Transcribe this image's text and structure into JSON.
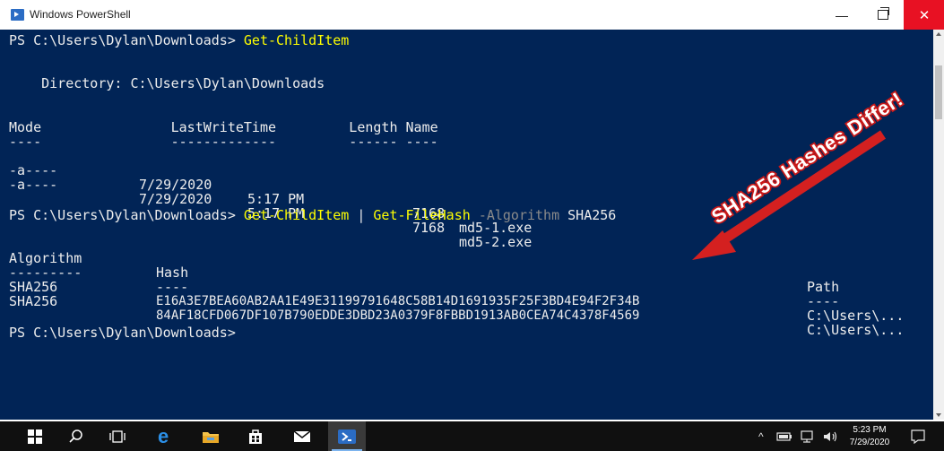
{
  "window": {
    "title": "Windows PowerShell",
    "minimize_glyph": "—",
    "close_glyph": "✕"
  },
  "console": {
    "prompt": "PS C:\\Users\\Dylan\\Downloads>",
    "cmd1": "Get-ChildItem",
    "directory_line": "    Directory: C:\\Users\\Dylan\\Downloads",
    "listing_header": "Mode                LastWriteTime         Length Name",
    "listing_rule": "----                -------------         ------ ----",
    "files": [
      {
        "mode": "-a----",
        "date": "7/29/2020",
        "time": "5:17 PM",
        "length": "7168",
        "name": "md5-1.exe"
      },
      {
        "mode": "-a----",
        "date": "7/29/2020",
        "time": "5:17 PM",
        "length": "7168",
        "name": "md5-2.exe"
      }
    ],
    "cmd2_part1": "Get-ChildItem",
    "cmd2_pipe": "|",
    "cmd2_part2": "Get-FileHash",
    "cmd2_param": "-Algorithm",
    "cmd2_value": "SHA256",
    "hash_columns": {
      "algorithm": "Algorithm",
      "hash": "Hash",
      "path": "Path"
    },
    "hash_rules": {
      "algorithm": "---------",
      "hash": "----",
      "path": "----"
    },
    "hashes": [
      {
        "algorithm": "SHA256",
        "hash": "E16A3E7BEA60AB2AA1E49E31199791648C58B14D1691935F25F3BD4E94F2F34B",
        "path": "C:\\Users\\..."
      },
      {
        "algorithm": "SHA256",
        "hash": "84AF18CFD067DF107B790EDDE3DBD23A0379F8FBBD1913AB0CEA74C4378F4569",
        "path": "C:\\Users\\..."
      }
    ],
    "final_prompt": "PS C:\\Users\\Dylan\\Downloads>"
  },
  "annotation": {
    "text": "SHA256 Hashes Differ!",
    "text_color": "#ffffff",
    "arrow_color": "#d42020"
  },
  "taskbar": {
    "icons": [
      "windows-start-icon",
      "search-icon",
      "task-view-icon",
      "edge-icon",
      "file-explorer-icon",
      "store-icon",
      "mail-icon",
      "powershell-icon"
    ],
    "tray_glyphs": "^",
    "clock_time": "5:23 PM",
    "clock_date": "7/29/2020"
  },
  "colors": {
    "console_bg": "#012456",
    "console_fg": "#ededed",
    "command": "#ffff00",
    "parameter": "#8a8a8a",
    "close_button": "#e81123"
  }
}
